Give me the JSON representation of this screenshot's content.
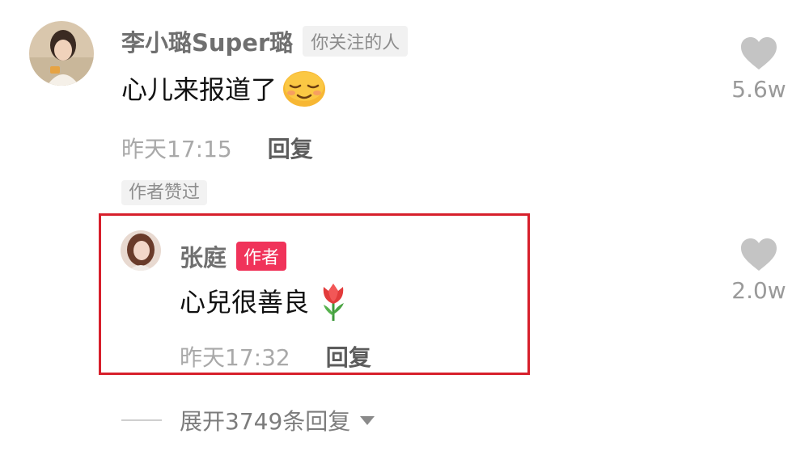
{
  "comment": {
    "username": "李小璐Super璐",
    "follow_tag": "你关注的人",
    "text": "心儿来报道了",
    "emoji_icon": "relieved-face-emoji",
    "time": "昨天17:15",
    "reply_label": "回复",
    "liked_by_author": "作者赞过",
    "like_count": "5.6w"
  },
  "reply": {
    "username": "张庭",
    "author_tag": "作者",
    "text": "心兒很善良",
    "emoji_icon": "tulip-emoji",
    "time": "昨天17:32",
    "reply_label": "回复",
    "like_count": "2.0w"
  },
  "expand": {
    "label": "展开3749条回复"
  },
  "colors": {
    "highlight_border": "#d71f2b",
    "author_tag_bg": "#f0335a",
    "heart": "#c4c4c4"
  }
}
